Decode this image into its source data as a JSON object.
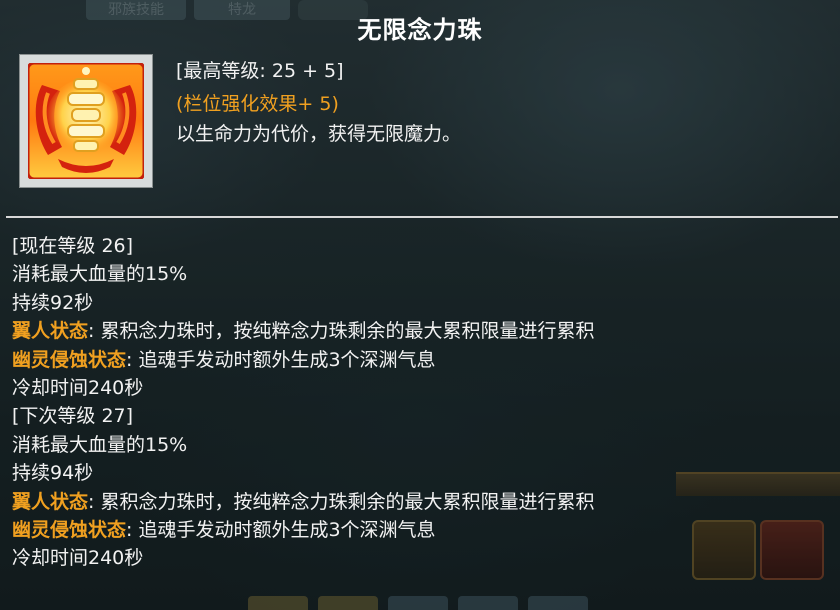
{
  "skill": {
    "title": "无限念力珠",
    "max_level": "[最高等级: 25 + 5]",
    "slot_bonus": "(栏位强化效果+ 5)",
    "description": "以生命力为代价，获得无限魔力。"
  },
  "current_level": {
    "header": "[现在等级 26]",
    "lines": [
      "消耗最大血量的15%",
      "持续92秒"
    ],
    "wing_tag": "翼人状态",
    "wing_text": ": 累积念力珠时，按纯粹念力珠剩余的最大累积限量进行累积",
    "ghost_tag": "幽灵侵蚀状态",
    "ghost_text": ": 追魂手发动时额外生成3个深渊气息",
    "cooldown": "冷却时间240秒"
  },
  "next_level": {
    "header": "[下次等级 27]",
    "lines": [
      "消耗最大血量的15%",
      "持续94秒"
    ],
    "wing_tag": "翼人状态",
    "wing_text": ": 累积念力珠时，按纯粹念力珠剩余的最大累积限量进行累积",
    "ghost_tag": "幽灵侵蚀状态",
    "ghost_text": ": 追魂手发动时额外生成3个深渊气息",
    "cooldown": "冷却时间240秒"
  },
  "background_ui": {
    "tab_1": "邪族技能",
    "tab_2": "特龙"
  },
  "colors": {
    "title": "#ffffff",
    "text": "#f2f2f2",
    "accent_orange": "#f0a020",
    "divider": "#d8d8d8"
  },
  "icons": {
    "skill_icon": "golden-bead-wings-icon"
  }
}
